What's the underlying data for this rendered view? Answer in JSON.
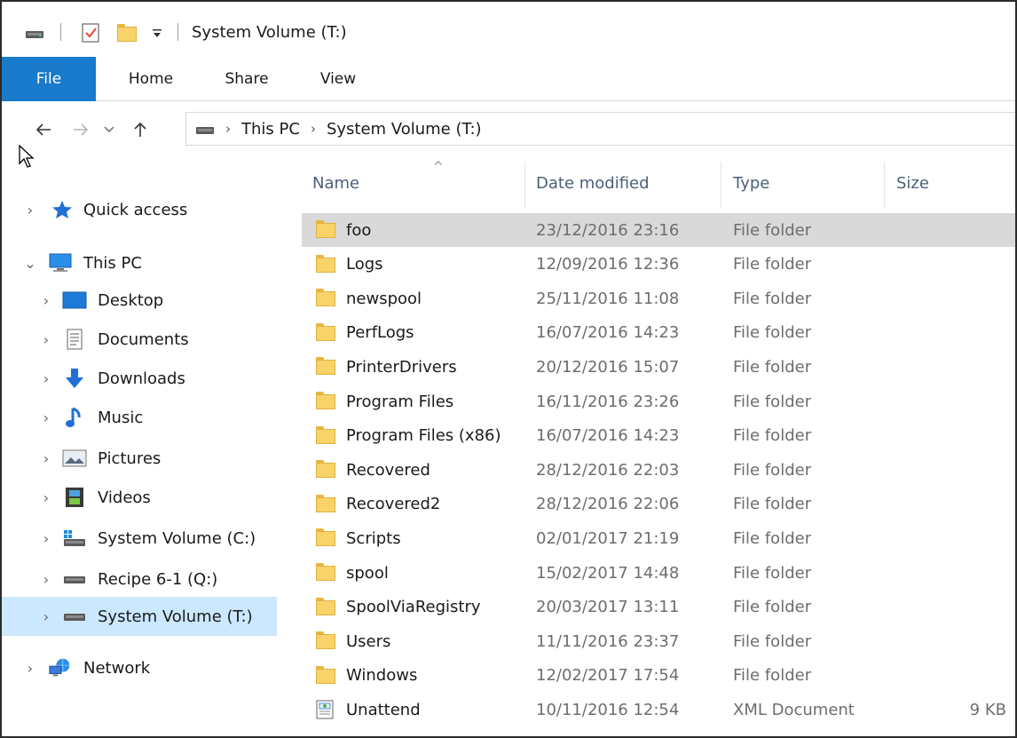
{
  "window": {
    "title": "System Volume (T:)",
    "accent": "#1979ca",
    "selected_tree_bg": "#cce8ff",
    "selected_row_bg": "#d9d9d9"
  },
  "quick_access_toolbar": {
    "icons": [
      "drive-icon",
      "properties-checkbox-icon",
      "new-folder-icon",
      "customize-dropdown-icon"
    ]
  },
  "ribbon": {
    "tabs": [
      {
        "label": "File"
      },
      {
        "label": "Home"
      },
      {
        "label": "Share"
      },
      {
        "label": "View"
      }
    ]
  },
  "address": {
    "back_icon": "arrow-left-icon",
    "forward_icon": "arrow-right-icon",
    "recent_icon": "chevron-down-icon",
    "up_icon": "arrow-up-icon",
    "crumbs": [
      "This PC",
      "System Volume (T:)"
    ]
  },
  "nav_pane": {
    "items": [
      {
        "label": "Quick access",
        "icon": "star-icon"
      },
      {
        "label": "This PC",
        "icon": "computer-icon"
      },
      {
        "label": "Desktop",
        "icon": "desktop-icon"
      },
      {
        "label": "Documents",
        "icon": "documents-icon"
      },
      {
        "label": "Downloads",
        "icon": "download-icon"
      },
      {
        "label": "Music",
        "icon": "music-icon"
      },
      {
        "label": "Pictures",
        "icon": "pictures-icon"
      },
      {
        "label": "Videos",
        "icon": "videos-icon"
      },
      {
        "label": "System Volume (C:)",
        "icon": "system-drive-icon"
      },
      {
        "label": "Recipe 6-1 (Q:)",
        "icon": "drive-icon"
      },
      {
        "label": "System Volume (T:)",
        "icon": "drive-icon"
      },
      {
        "label": "Network",
        "icon": "network-icon"
      }
    ]
  },
  "file_list": {
    "columns": [
      "Name",
      "Date modified",
      "Type",
      "Size"
    ],
    "rows": [
      {
        "name": "foo",
        "date": "23/12/2016 23:16",
        "type": "File folder",
        "size": "",
        "icon": "folder-icon"
      },
      {
        "name": "Logs",
        "date": "12/09/2016 12:36",
        "type": "File folder",
        "size": "",
        "icon": "folder-icon"
      },
      {
        "name": "newspool",
        "date": "25/11/2016 11:08",
        "type": "File folder",
        "size": "",
        "icon": "folder-icon"
      },
      {
        "name": "PerfLogs",
        "date": "16/07/2016 14:23",
        "type": "File folder",
        "size": "",
        "icon": "folder-icon"
      },
      {
        "name": "PrinterDrivers",
        "date": "20/12/2016 15:07",
        "type": "File folder",
        "size": "",
        "icon": "folder-icon"
      },
      {
        "name": "Program Files",
        "date": "16/11/2016 23:26",
        "type": "File folder",
        "size": "",
        "icon": "folder-icon"
      },
      {
        "name": "Program Files (x86)",
        "date": "16/07/2016 14:23",
        "type": "File folder",
        "size": "",
        "icon": "folder-icon"
      },
      {
        "name": "Recovered",
        "date": "28/12/2016 22:03",
        "type": "File folder",
        "size": "",
        "icon": "folder-icon"
      },
      {
        "name": "Recovered2",
        "date": "28/12/2016 22:06",
        "type": "File folder",
        "size": "",
        "icon": "folder-icon"
      },
      {
        "name": "Scripts",
        "date": "02/01/2017 21:19",
        "type": "File folder",
        "size": "",
        "icon": "folder-icon"
      },
      {
        "name": "spool",
        "date": "15/02/2017 14:48",
        "type": "File folder",
        "size": "",
        "icon": "folder-icon"
      },
      {
        "name": "SpoolViaRegistry",
        "date": "20/03/2017 13:11",
        "type": "File folder",
        "size": "",
        "icon": "folder-icon"
      },
      {
        "name": "Users",
        "date": "11/11/2016 23:37",
        "type": "File folder",
        "size": "",
        "icon": "folder-icon"
      },
      {
        "name": "Windows",
        "date": "12/02/2017 17:54",
        "type": "File folder",
        "size": "",
        "icon": "folder-icon"
      },
      {
        "name": "Unattend",
        "date": "10/11/2016 12:54",
        "type": "XML Document",
        "size": "9 KB",
        "icon": "xml-document-icon"
      }
    ]
  }
}
